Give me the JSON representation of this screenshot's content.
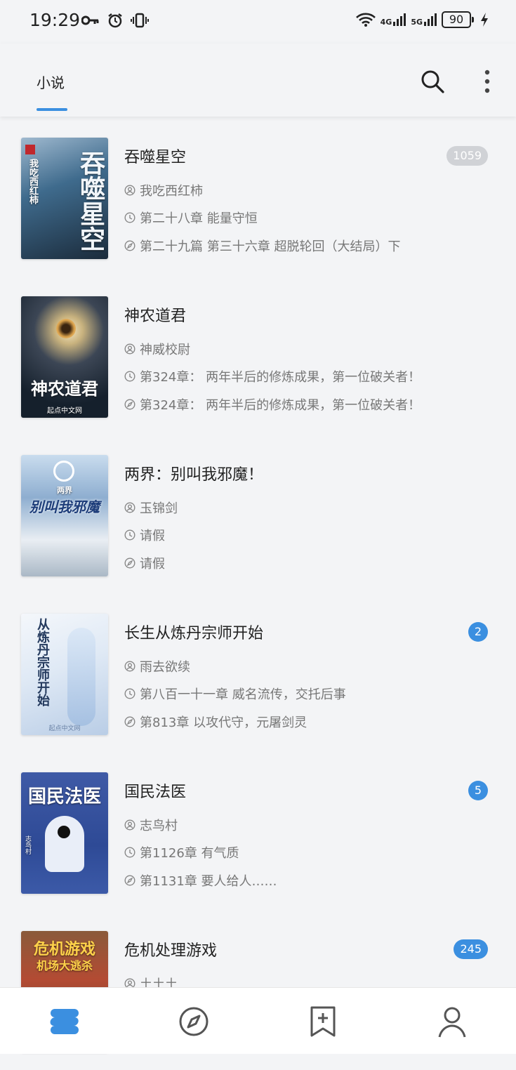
{
  "status": {
    "time": "19:29",
    "net1": "4G",
    "net2": "5G",
    "battery": "90"
  },
  "appbar": {
    "tab_label": "小说",
    "accent": "#3b8fe0"
  },
  "books": [
    {
      "title": "吞噬星空",
      "author": "我吃西红柿",
      "latest": "第二十八章 能量守恒",
      "read": "第二十九篇 第三十六章 超脱轮回（大结局）下",
      "badge": "1059",
      "badge_style": "gray",
      "cover_text": "吞噬星空",
      "cover_sub": "我吃西红柿"
    },
    {
      "title": "神农道君",
      "author": "神威校尉",
      "latest": "第324章： 两年半后的修炼成果，第一位破关者！",
      "read": "第324章： 两年半后的修炼成果，第一位破关者！",
      "badge": "",
      "cover_text": "神农道君",
      "cover_sub": "起点中文网"
    },
    {
      "title": "两界：别叫我邪魔！",
      "author": "玉锦剑",
      "latest": "请假",
      "read": "请假",
      "badge": "",
      "cover_text": "别叫我邪魔",
      "cover_sub": "两界"
    },
    {
      "title": "长生从炼丹宗师开始",
      "author": "雨去欲续",
      "latest": "第八百一十一章 威名流传，交托后事",
      "read": "第813章 以攻代守，元屠剑灵",
      "badge": "2",
      "badge_style": "blue",
      "cover_text": "从炼丹宗师开始",
      "cover_sub": "起点中文网"
    },
    {
      "title": "国民法医",
      "author": "志鸟村",
      "latest": "第1126章 有气质",
      "read": "第1131章 要人给人……",
      "badge": "5",
      "badge_style": "blue",
      "cover_text": "国民法医",
      "cover_sub": "志鸟村"
    },
    {
      "title": "危机处理游戏",
      "author": "土土土",
      "latest": "",
      "read": "",
      "badge": "245",
      "badge_style": "blue",
      "cover_text": "危机游戏",
      "cover_sub": "机场大逃杀"
    }
  ],
  "icons": [
    "key-icon",
    "alarm-icon",
    "vibrate-icon",
    "wifi-icon",
    "signal-icon",
    "battery-icon",
    "charging-icon",
    "search-icon",
    "more-icon",
    "author-icon",
    "clock-icon",
    "compass-icon",
    "bookshelf-icon",
    "explore-icon",
    "bookmark-add-icon",
    "profile-icon"
  ]
}
